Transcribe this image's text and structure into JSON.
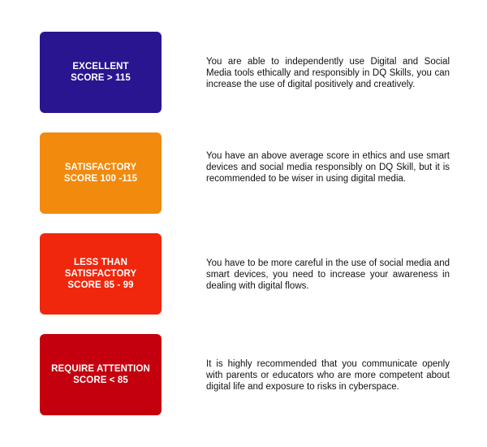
{
  "tiers": [
    {
      "label_lines": [
        "EXCELLENT",
        "SCORE > 115"
      ],
      "color": "#2a1590",
      "description": "You are able to independently use Digital and Social Media tools ethically and responsibly in DQ Skills, you can increase the use of digital positively and creatively."
    },
    {
      "label_lines": [
        "SATISFACTORY",
        "SCORE 100 -115"
      ],
      "color": "#f28a0e",
      "description": "You have an above average score in ethics and use smart devices and social media responsibly on DQ Skill, but it is recommended to be wiser in using digital media."
    },
    {
      "label_lines": [
        "LESS THAN",
        "SATISFACTORY",
        "SCORE 85 - 99"
      ],
      "color": "#f0270c",
      "description": "You have to be more careful in the use of social media and smart devices, you need to increase your awareness in dealing with digital flows."
    },
    {
      "label_lines": [
        "REQUIRE ATTENTION",
        "SCORE < 85"
      ],
      "color": "#c4000f",
      "description": "It is highly recommended that you communicate openly with parents or educators who are more competent about digital life and exposure to risks in cyberspace."
    }
  ]
}
